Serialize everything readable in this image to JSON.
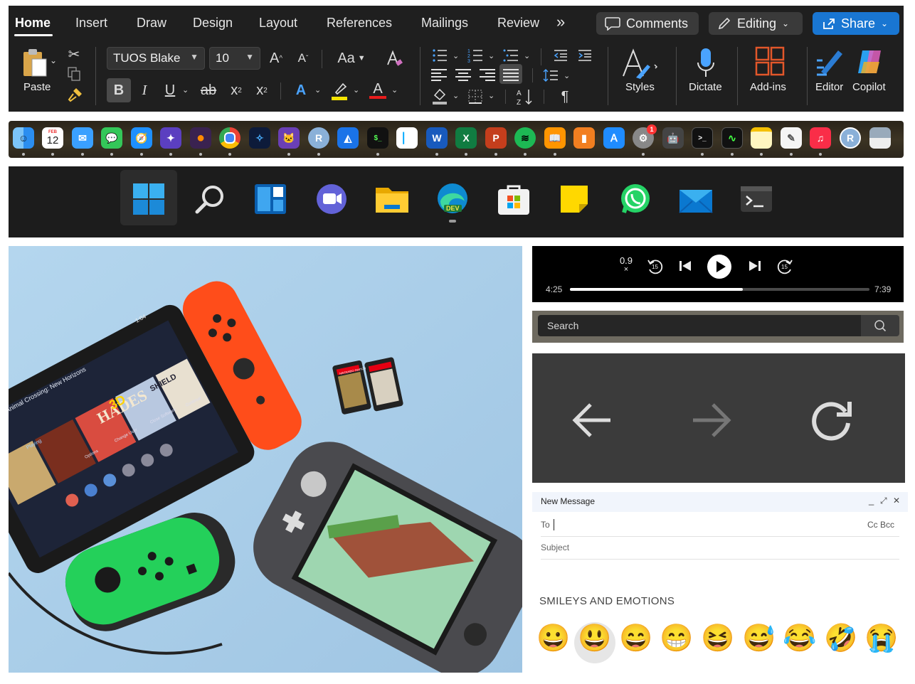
{
  "word_ribbon": {
    "tabs": [
      "Home",
      "Insert",
      "Draw",
      "Design",
      "Layout",
      "References",
      "Mailings",
      "Review"
    ],
    "more_tabs": "»",
    "comments_label": "Comments",
    "editing_label": "Editing",
    "share_label": "Share",
    "paste_label": "Paste",
    "font_name": "TUOS Blake",
    "font_size": "10",
    "bold": "B",
    "italic": "I",
    "underline": "U",
    "strike": "ab",
    "subscript": "x",
    "subscript_mark": "2",
    "superscript": "x",
    "superscript_mark": "2",
    "grow_font": "A",
    "shrink_font": "A",
    "change_case": "Aa",
    "styles_label": "Styles",
    "dictate_label": "Dictate",
    "addins_label": "Add-ins",
    "editor_label": "Editor",
    "copilot_label": "Copilot",
    "pilcrow": "¶",
    "accent_color": "#1976d2"
  },
  "mac_dock": {
    "calendar_month": "FEB",
    "calendar_day": "12",
    "settings_badge": "1",
    "r_letter": "R",
    "r2_letter": "R",
    "word_letter": "W",
    "excel_letter": "X",
    "ppt_letter": "P",
    "terminal_text": "$_"
  },
  "windows_taskbar": {
    "edge_badge": "DEV",
    "icons": [
      "windows-start",
      "search",
      "widgets",
      "teams",
      "file-explorer",
      "edge-dev",
      "microsoft-store",
      "sticky-notes",
      "whatsapp",
      "mail",
      "terminal"
    ]
  },
  "photo": {
    "screen_title": "Animal Crossing: New Horizons",
    "game_1": "HADES",
    "game_2": "3D",
    "game_3": "SHIELD",
    "status_playing": "Playing",
    "menu_options": "Options",
    "menu_change_user": "Change User",
    "menu_close": "Close Software",
    "menu_continue": "Continue",
    "cart_brand": "NINTENDO SWITCH",
    "clock": "1:04"
  },
  "media_player": {
    "speed": "0.9",
    "speed_suffix": "×",
    "rewind_seconds": "15",
    "forward_seconds": "15",
    "elapsed": "4:25",
    "total": "7:39",
    "progress_fraction": 0.578
  },
  "search_bar": {
    "placeholder": "Search"
  },
  "nav_controls": {
    "back": "back",
    "forward": "forward",
    "reload": "reload"
  },
  "compose": {
    "title": "New Message",
    "minimize": "_",
    "expand": "⤢",
    "close": "✕",
    "to_label": "To",
    "cc_bcc": "Cc Bcc",
    "subject_placeholder": "Subject"
  },
  "emoji_picker": {
    "section_title": "SMILEYS AND EMOTIONS",
    "emojis": [
      "😀",
      "😃",
      "😄",
      "😁",
      "😆",
      "😅",
      "😂",
      "🤣",
      "😭"
    ],
    "selected_index": 1
  }
}
